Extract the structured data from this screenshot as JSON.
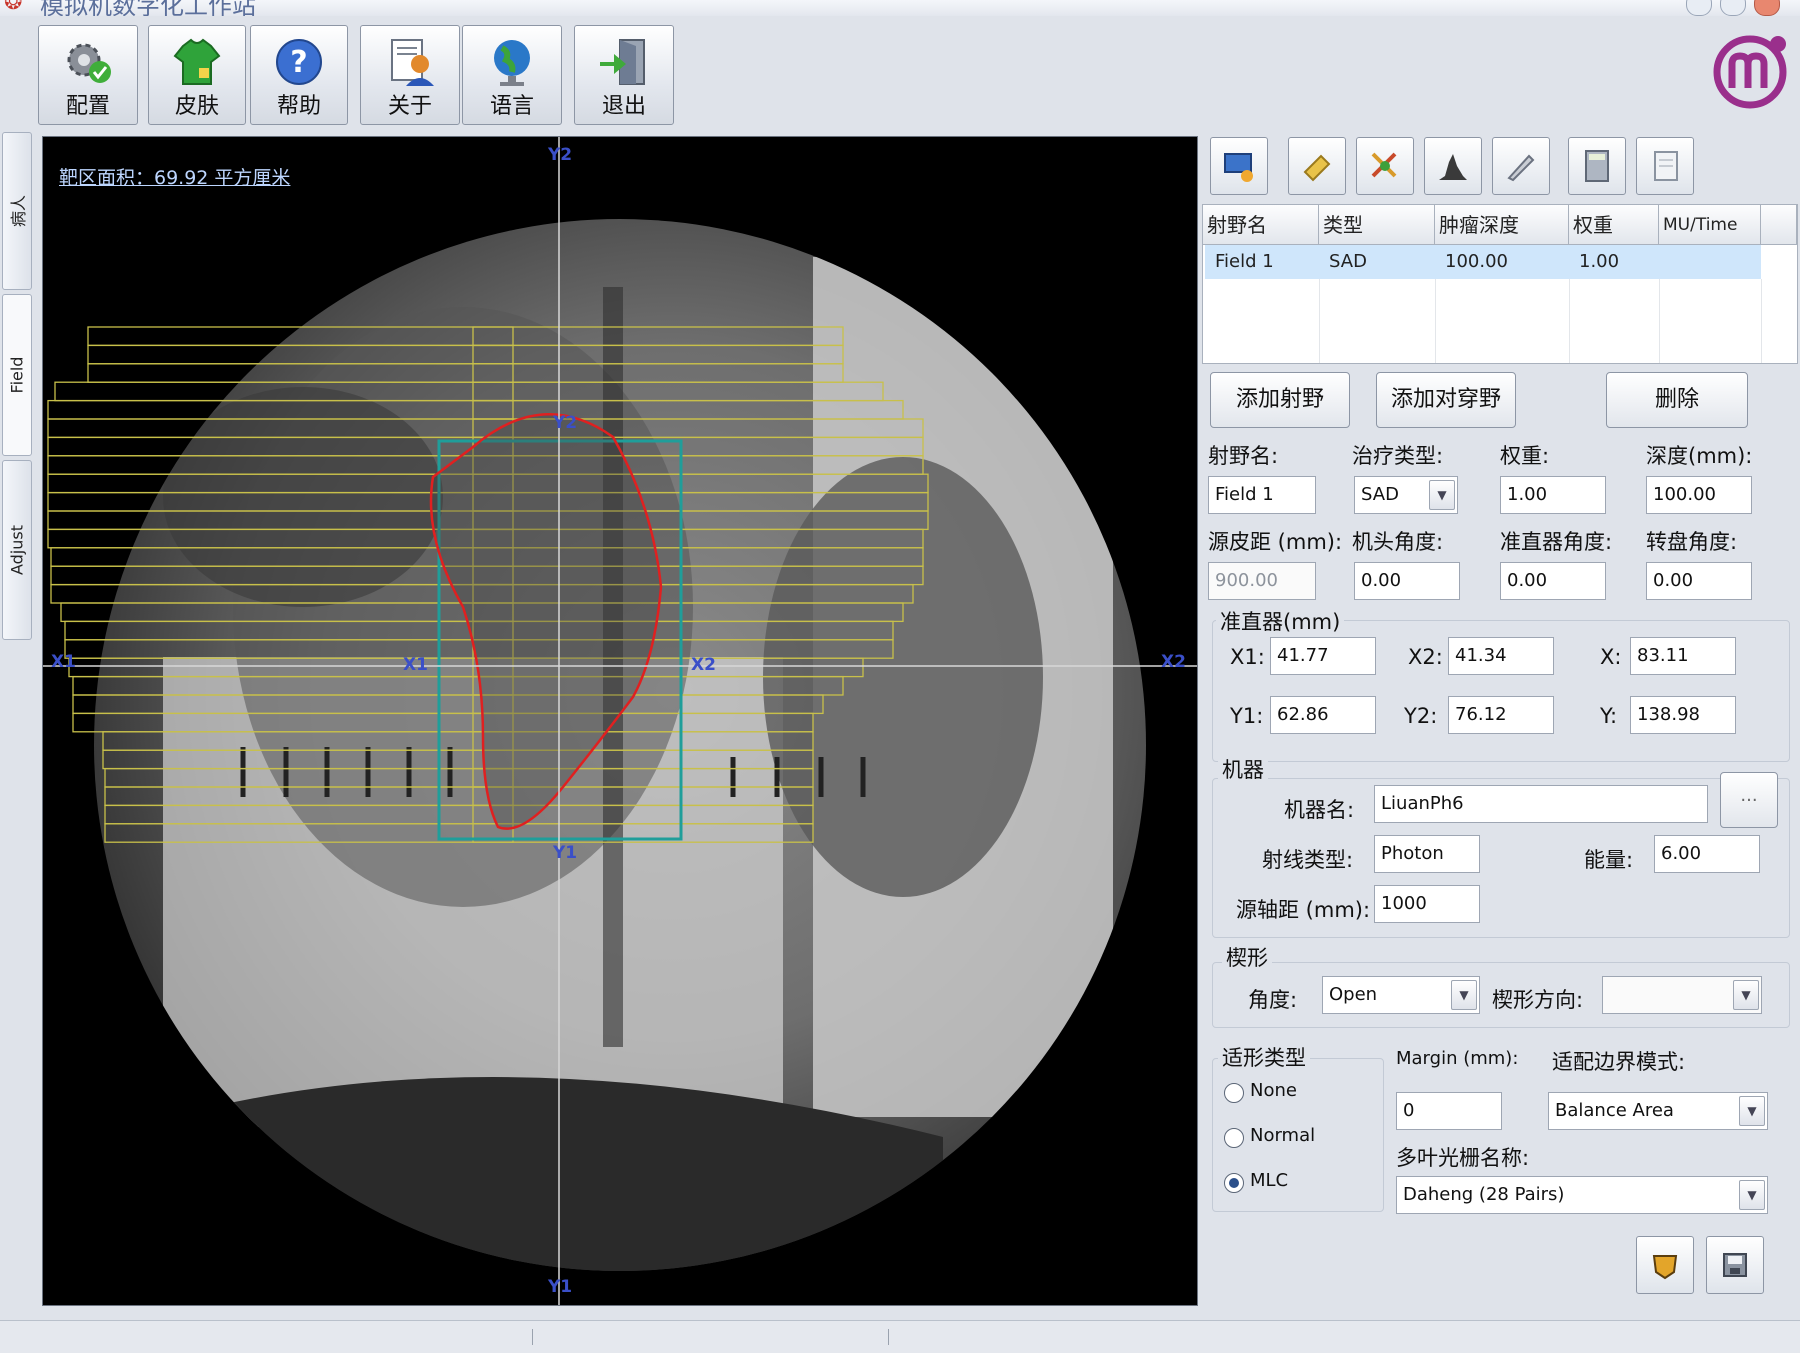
{
  "window": {
    "title": "模拟机数字化工作站"
  },
  "toolbar": {
    "buttons": [
      {
        "label": "配置",
        "icon": "settings-gear-icon"
      },
      {
        "label": "皮肤",
        "icon": "shirt-icon"
      },
      {
        "label": "帮助",
        "icon": "help-icon"
      },
      {
        "label": "关于",
        "icon": "about-document-icon"
      },
      {
        "label": "语言",
        "icon": "globe-icon"
      },
      {
        "label": "退出",
        "icon": "exit-door-icon"
      }
    ]
  },
  "side_tabs": {
    "patient": "病人",
    "field": "Field",
    "adjust": "Adjust"
  },
  "viewer": {
    "area_label": "靶区面积：69.92 平方厘米",
    "axis": {
      "y2": "Y2",
      "y1": "Y1",
      "x1": "X1",
      "x2": "X2"
    },
    "jaw": {
      "y2": "Y2",
      "y1": "Y1",
      "x1": "X1",
      "x2": "X2"
    },
    "colors": {
      "mlc": "#c8c04a",
      "jaw": "#1f9e9a",
      "target": "#e02020",
      "crosshair": "#d8d8d8"
    }
  },
  "tools": [
    "display-icon",
    "eraser-icon",
    "mlc-edit-icon",
    "histogram-icon",
    "pen-icon",
    "calculator-icon",
    "document-icon"
  ],
  "field_table": {
    "headers": [
      "射野名",
      "类型",
      "肿瘤深度",
      "权重",
      "MU/Time"
    ],
    "rows": [
      [
        "Field 1",
        "SAD",
        "100.00",
        "1.00",
        ""
      ]
    ]
  },
  "actions": {
    "add_field": "添加射野",
    "add_opposed": "添加对穿野",
    "delete": "删除"
  },
  "field_form": {
    "name_label": "射野名:",
    "name": "Field 1",
    "therapy_type_label": "治疗类型:",
    "therapy_type": "SAD",
    "weight_label": "权重:",
    "weight": "1.00",
    "depth_label": "深度(mm):",
    "depth": "100.00",
    "ssd_label": "源皮距 (mm):",
    "ssd": "900.00",
    "gantry_label": "机头角度:",
    "gantry": "0.00",
    "collimator_label": "准直器角度:",
    "collimator": "0.00",
    "couch_label": "转盘角度:",
    "couch": "0.00"
  },
  "jaws": {
    "title": "准直器(mm)",
    "x1_label": "X1:",
    "x1": "41.77",
    "x2_label": "X2:",
    "x2": "41.34",
    "x_label": "X:",
    "x": "83.11",
    "y1_label": "Y1:",
    "y1": "62.86",
    "y2_label": "Y2:",
    "y2": "76.12",
    "y_label": "Y:",
    "y": "138.98"
  },
  "machine": {
    "title": "机器",
    "name_label": "机器名:",
    "name": "LiuanPh6",
    "browse": "...",
    "ray_label": "射线类型:",
    "ray": "Photon",
    "energy_label": "能量:",
    "energy": "6.00",
    "sad_label": "源轴距 (mm):",
    "sad": "1000"
  },
  "wedge": {
    "title": "楔形",
    "angle_label": "角度:",
    "angle": "Open",
    "dir_label": "楔形方向:",
    "dir": ""
  },
  "conform": {
    "title": "适形类型",
    "options": [
      "None",
      "Normal",
      "MLC"
    ],
    "selected": "MLC",
    "margin_label": "Margin (mm):",
    "margin": "0",
    "fit_mode_label": "适配边界模式:",
    "fit_mode": "Balance Area",
    "mlc_name_label": "多叶光栅名称:",
    "mlc_name": "Daheng (28 Pairs)"
  }
}
